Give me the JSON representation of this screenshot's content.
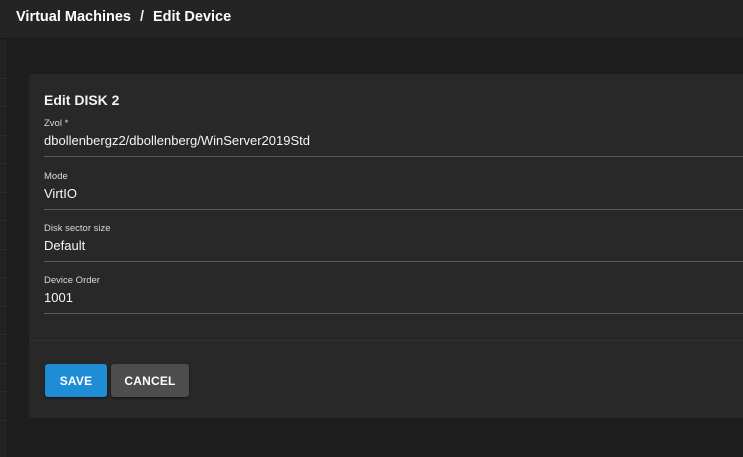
{
  "breadcrumb": {
    "parent": "Virtual Machines",
    "separator": "/",
    "current": "Edit Device"
  },
  "form": {
    "title": "Edit DISK 2",
    "fields": [
      {
        "label": "Zvol *",
        "value": "dbollenbergz2/dbollenberg/WinServer2019Std"
      },
      {
        "label": "Mode",
        "value": "VirtIO"
      },
      {
        "label": "Disk sector size",
        "value": "Default"
      },
      {
        "label": "Device Order",
        "value": "1001"
      }
    ]
  },
  "actions": {
    "save_label": "SAVE",
    "cancel_label": "CANCEL"
  },
  "colors": {
    "primary": "#1f8dd6",
    "background": "#1e1e1e",
    "card": "#282828",
    "cancel": "#4d4d4d"
  }
}
